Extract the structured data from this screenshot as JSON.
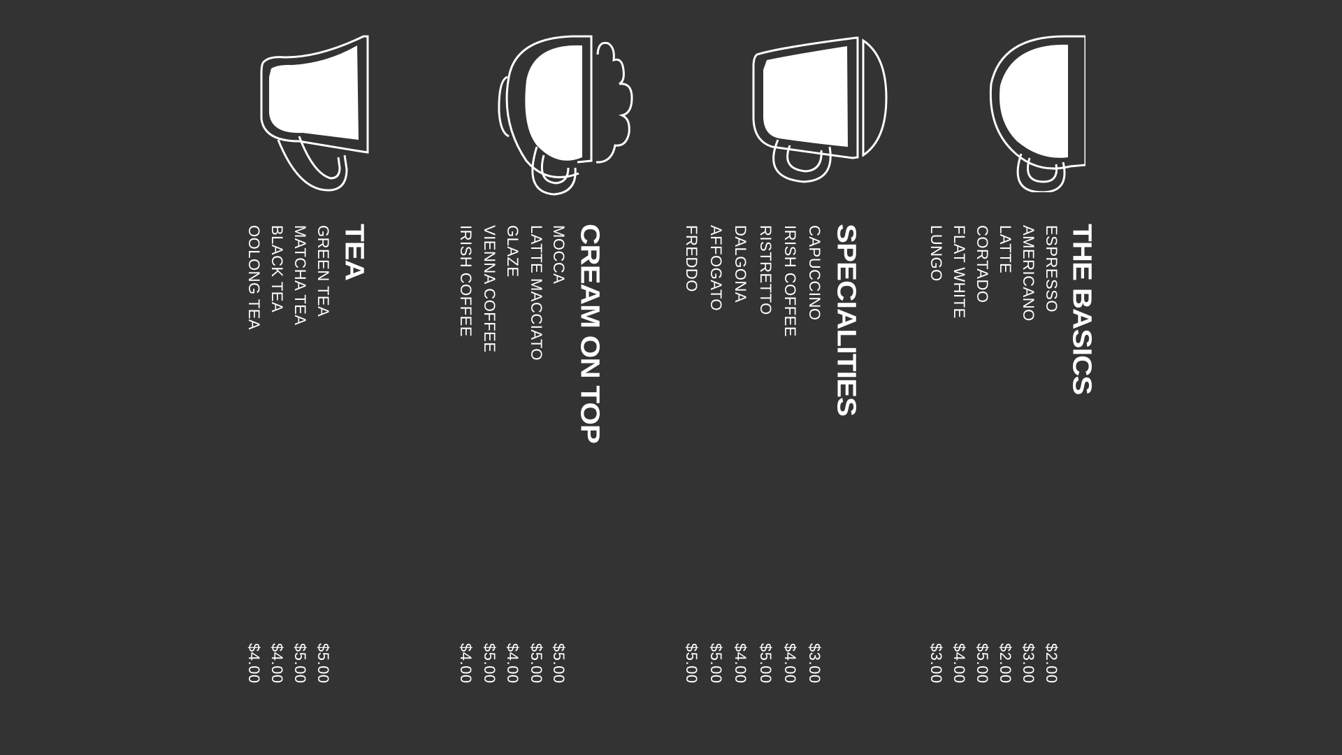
{
  "colors": {
    "background": "#333333",
    "foreground": "#ffffff"
  },
  "sections": [
    {
      "title": "TEA",
      "icon": "tea-cup-icon",
      "items": [
        {
          "name": "GREEN TEA",
          "price": "$5.00"
        },
        {
          "name": "MATCHA TEA",
          "price": "$5.00"
        },
        {
          "name": "BLACK TEA",
          "price": "$4.00"
        },
        {
          "name": "OOLONG TEA",
          "price": "$4.00"
        }
      ]
    },
    {
      "title": "CREAM ON TOP",
      "icon": "cream-cup-icon",
      "items": [
        {
          "name": "MOCCA",
          "price": "$5.00"
        },
        {
          "name": "LATTE MACCIATO",
          "price": "$5.00"
        },
        {
          "name": "GLAZE",
          "price": "$4.00"
        },
        {
          "name": "VIENNA COFFEE",
          "price": "$5.00"
        },
        {
          "name": "IRISH COFFEE",
          "price": "$4.00"
        }
      ]
    },
    {
      "title": "SPECIALITIES",
      "icon": "specialty-cup-icon",
      "items": [
        {
          "name": "CAPUCCINO",
          "price": "$3.00"
        },
        {
          "name": "IRISH COFFEE",
          "price": "$4.00"
        },
        {
          "name": "RISTRETTO",
          "price": "$5.00"
        },
        {
          "name": "DALGONA",
          "price": "$4.00"
        },
        {
          "name": "AFFOGATO",
          "price": "$5.00"
        },
        {
          "name": "FREDDO",
          "price": "$5.00"
        }
      ]
    },
    {
      "title": "THE BASICS",
      "icon": "espresso-cup-icon",
      "items": [
        {
          "name": "ESPRESSO",
          "price": "$2.00"
        },
        {
          "name": "AMERICANO",
          "price": "$3.00"
        },
        {
          "name": "LATTE",
          "price": "$2.00"
        },
        {
          "name": "CORTADO",
          "price": "$5.00"
        },
        {
          "name": "FLAT WHITE",
          "price": "$4.00"
        },
        {
          "name": "LUNGO",
          "price": "$3.00"
        }
      ]
    }
  ]
}
